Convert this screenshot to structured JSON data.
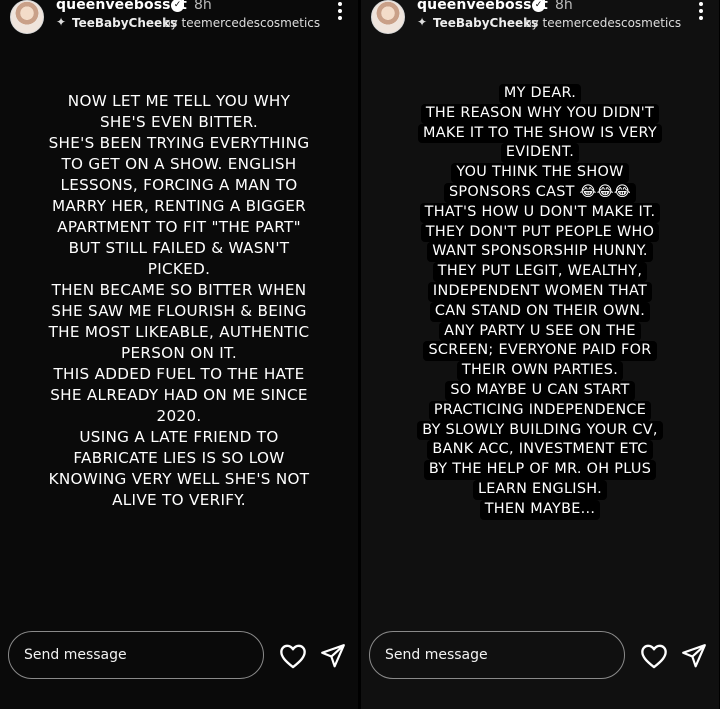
{
  "stories": [
    {
      "username": "queenveebosset",
      "time": "8h",
      "track_artist": "TeeBabyCheeks",
      "track_by": "by teemercedescosmetics",
      "text_lines": [
        "NOW LET ME TELL YOU WHY",
        "SHE'S EVEN BITTER.",
        "SHE'S BEEN TRYING EVERYTHING",
        "TO GET ON A SHOW. ENGLISH",
        "LESSONS, FORCING A MAN TO",
        "MARRY HER, RENTING A BIGGER",
        "APARTMENT TO FIT \"THE PART\"",
        "BUT STILL FAILED & WASN'T",
        "PICKED.",
        "THEN BECAME SO BITTER WHEN",
        "SHE SAW ME FLOURISH & BEING",
        "THE MOST LIKEABLE, AUTHENTIC",
        "PERSON ON IT.",
        "THIS ADDED FUEL TO THE HATE",
        "SHE ALREADY HAD ON ME SINCE",
        "2020.",
        "USING A LATE FRIEND TO",
        "FABRICATE LIES IS SO LOW",
        "KNOWING VERY WELL SHE'S NOT",
        "ALIVE TO VERIFY."
      ],
      "reply_placeholder": "Send message"
    },
    {
      "username": "queenveebosset",
      "time": "8h",
      "track_artist": "TeeBabyCheeks",
      "track_by": "by teemercedescosmetics",
      "text_lines": [
        "MY DEAR.",
        "THE REASON WHY YOU DIDN'T",
        "MAKE IT TO THE SHOW IS VERY",
        "EVIDENT.",
        "YOU THINK THE SHOW",
        "SPONSORS CAST 😂😂😂",
        "THAT'S HOW U DON'T MAKE IT.",
        "THEY DON'T PUT PEOPLE WHO",
        "WANT SPONSORSHIP HUNNY.",
        "THEY PUT LEGIT, WEALTHY,",
        "INDEPENDENT WOMEN THAT",
        "CAN STAND ON THEIR OWN.",
        "ANY PARTY U SEE ON THE",
        "SCREEN; EVERYONE PAID FOR",
        "THEIR OWN PARTIES.",
        "SO MAYBE U CAN START",
        "PRACTICING INDEPENDENCE",
        "BY SLOWLY BUILDING YOUR CV,",
        "BANK ACC, INVESTMENT ETC",
        "BY THE HELP OF MR. OH PLUS",
        "LEARN ENGLISH.",
        "THEN MAYBE..."
      ],
      "reply_placeholder": "Send message"
    }
  ],
  "icons": {
    "verified": "verified-badge-icon",
    "music": "music-sparkle-icon",
    "more": "more-vertical-icon",
    "like": "heart-icon",
    "send": "send-icon"
  },
  "colors": {
    "background": "#000000",
    "text": "#ffffff",
    "muted": "#bbbbbb",
    "reply_border": "#8a8a8a"
  }
}
